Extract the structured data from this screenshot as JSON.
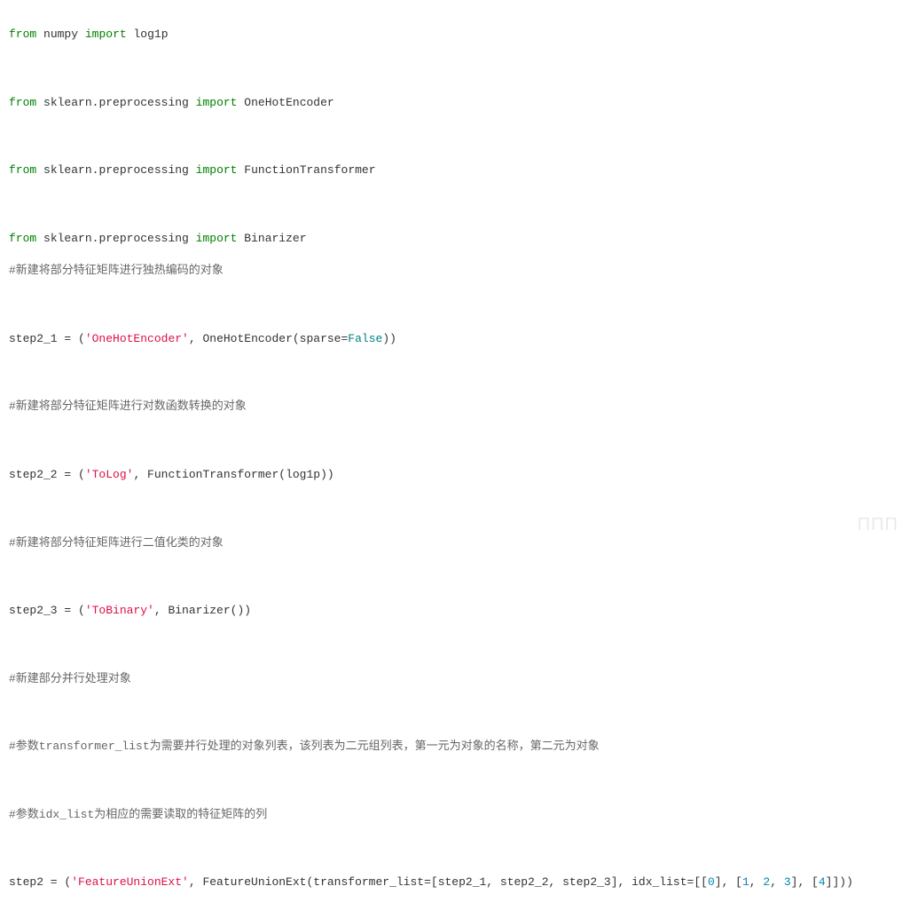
{
  "lines": {
    "l1_from": "from",
    "l1_mod": "numpy",
    "l1_imp": "import",
    "l1_name": "log1p",
    "l2_from": "from",
    "l2_mod": "sklearn.preprocessing",
    "l2_imp": "import",
    "l2_name": "OneHotEncoder",
    "l3_from": "from",
    "l3_mod": "sklearn.preprocessing",
    "l3_imp": "import",
    "l3_name": "FunctionTransformer",
    "l4_from": "from",
    "l4_mod": "sklearn.preprocessing",
    "l4_imp": "import",
    "l4_name": "Binarizer",
    "c1": "#新建将部分特征矩阵进行独热编码的对象",
    "s21_a": "step2_1 = (",
    "s21_str": "'OneHotEncoder'",
    "s21_b": ", OneHotEncoder(sparse=",
    "s21_false": "False",
    "s21_c": "))",
    "c2": "#新建将部分特征矩阵进行对数函数转换的对象",
    "s22_a": "step2_2 = (",
    "s22_str": "'ToLog'",
    "s22_b": ", FunctionTransformer(log1p))",
    "c3": "#新建将部分特征矩阵进行二值化类的对象",
    "s23_a": "step2_3 = (",
    "s23_str": "'ToBinary'",
    "s23_b": ", Binarizer())",
    "c4": "#新建部分并行处理对象",
    "c5": "#参数transformer_list为需要并行处理的对象列表，该列表为二元组列表，第一元为对象的名称，第二元为对象",
    "c6": "#参数idx_list为相应的需要读取的特征矩阵的列",
    "s2_a": "step2 = (",
    "s2_str": "'FeatureUnionExt'",
    "s2_b": ", FeatureUnionExt(transformer_list=[step2_1, step2_2, step2_3], idx_list=[[",
    "n0": "0",
    "s2_c": "], [",
    "n1": "1",
    "s2_d": ", ",
    "n2": "2",
    "s2_e": ", ",
    "n3": "3",
    "s2_f": "], [",
    "n4": "4",
    "s2_g": "]]))"
  },
  "watermark": "ΠΠΠ"
}
